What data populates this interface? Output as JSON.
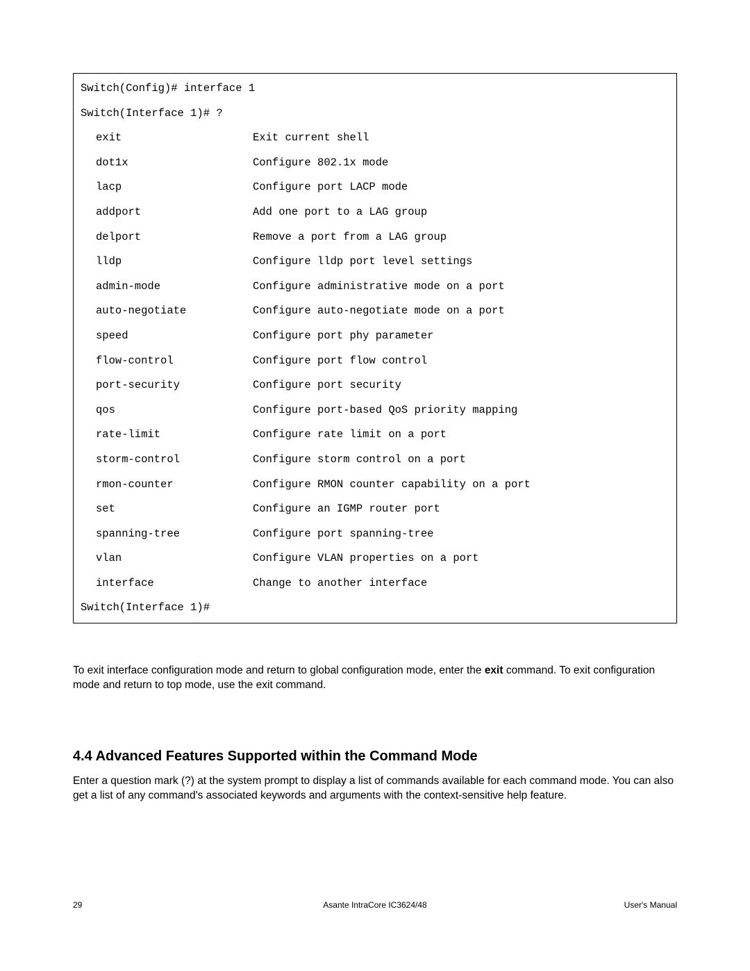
{
  "terminal": {
    "line1": "Switch(Config)# interface 1",
    "line2": "Switch(Interface 1)# ?",
    "commands": [
      {
        "name": "exit",
        "desc": "Exit current shell"
      },
      {
        "name": "dot1x",
        "desc": "Configure 802.1x mode"
      },
      {
        "name": "lacp",
        "desc": "Configure port LACP mode"
      },
      {
        "name": "addport",
        "desc": "Add one port to a LAG group"
      },
      {
        "name": "delport",
        "desc": "Remove a port from a LAG group"
      },
      {
        "name": "lldp",
        "desc": "Configure lldp port level settings"
      },
      {
        "name": "admin-mode",
        "desc": "Configure administrative mode on a port"
      },
      {
        "name": "auto-negotiate",
        "desc": "Configure auto-negotiate mode on a port"
      },
      {
        "name": "speed",
        "desc": "Configure port phy parameter"
      },
      {
        "name": "flow-control",
        "desc": "Configure port flow control"
      },
      {
        "name": "port-security",
        "desc": "Configure port security"
      },
      {
        "name": "qos",
        "desc": "Configure port-based QoS priority mapping"
      },
      {
        "name": "rate-limit",
        "desc": "Configure rate limit on a port"
      },
      {
        "name": "storm-control",
        "desc": "Configure storm control on a port"
      },
      {
        "name": "rmon-counter",
        "desc": "Configure RMON counter capability on a port"
      },
      {
        "name": "set",
        "desc": "Configure an IGMP router port"
      },
      {
        "name": "spanning-tree",
        "desc": "Configure port spanning-tree"
      },
      {
        "name": "vlan",
        "desc": "Configure VLAN properties on a port"
      },
      {
        "name": "interface",
        "desc": "Change to another interface"
      }
    ],
    "line3": "Switch(Interface 1)#"
  },
  "paragraph1_a": "To exit interface configuration mode and return to global configuration mode, enter the ",
  "paragraph1_bold": "exit",
  "paragraph1_b": " command. To exit configuration mode and return to top mode, use the exit command.",
  "heading": "4.4 Advanced Features Supported within the Command Mode",
  "paragraph2": "Enter a question mark (?) at the system prompt to display a list of commands available for each command mode. You can also get a list of any command's associated keywords and arguments with the context-sensitive help feature.",
  "footer": {
    "page": "29",
    "center": "Asante IntraCore IC3624/48",
    "right": "User's Manual"
  }
}
